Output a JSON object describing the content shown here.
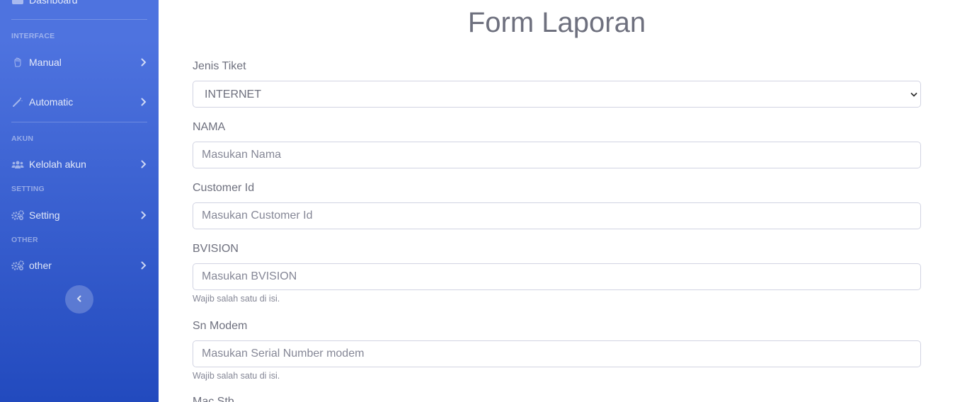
{
  "sidebar": {
    "dashboard_label": "Dashboard",
    "headings": {
      "interface": "INTERFACE",
      "akun": "AKUN",
      "setting": "SETTING",
      "other": "OTHER"
    },
    "items": [
      {
        "label": "Manual",
        "icon": "hand-icon"
      },
      {
        "label": "Automatic",
        "icon": "magic-wand-icon"
      },
      {
        "label": "Kelolah akun",
        "icon": "users-icon"
      },
      {
        "label": "Setting",
        "icon": "cogs-icon"
      },
      {
        "label": "other",
        "icon": "cogs-icon"
      }
    ],
    "colors": {
      "gradient_top": "#4e73df",
      "gradient_bottom": "#224abe"
    }
  },
  "form": {
    "title": "Form Laporan",
    "jenis_tiket": {
      "label": "Jenis Tiket",
      "value": "INTERNET"
    },
    "nama": {
      "label": "NAMA",
      "placeholder": "Masukan Nama"
    },
    "customer_id": {
      "label": "Customer Id",
      "placeholder": "Masukan Customer Id"
    },
    "bvision": {
      "label": "BVISION",
      "placeholder": "Masukan BVISION",
      "help": "Wajib salah satu di isi."
    },
    "sn_modem": {
      "label": "Sn Modem",
      "placeholder": "Masukan Serial Number modem",
      "help": "Wajib salah satu di isi."
    },
    "mac_stb": {
      "label": "Mac Stb"
    }
  }
}
